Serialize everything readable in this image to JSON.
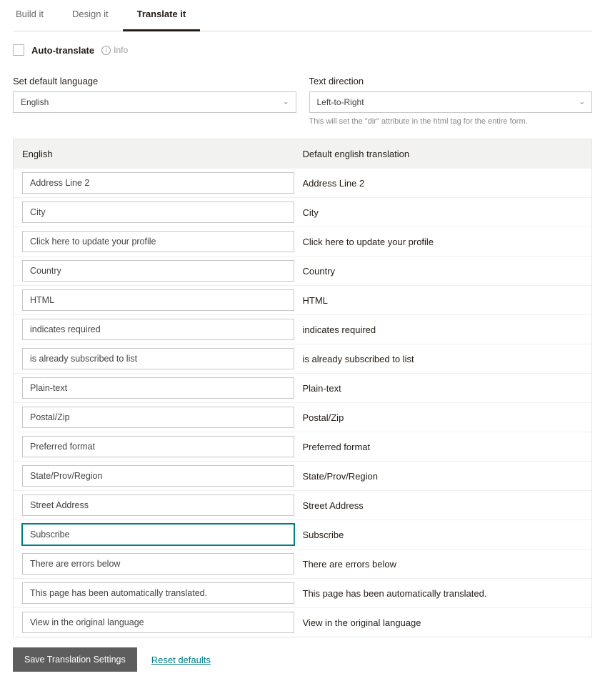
{
  "tabs": {
    "build": "Build it",
    "design": "Design it",
    "translate": "Translate it"
  },
  "autoTranslate": {
    "label": "Auto-translate",
    "info": "Info"
  },
  "defaultLanguage": {
    "label": "Set default language",
    "value": "English"
  },
  "textDirection": {
    "label": "Text direction",
    "value": "Left-to-Right",
    "help": "This will set the \"dir\" attribute in the html tag for the entire form."
  },
  "tableHeader": {
    "left": "English",
    "right": "Default english translation"
  },
  "rows": [
    {
      "input": "Address Line 2",
      "default": "Address Line 2",
      "focused": false
    },
    {
      "input": "City",
      "default": "City",
      "focused": false
    },
    {
      "input": "Click here to update your profile",
      "default": "Click here to update your profile",
      "focused": false
    },
    {
      "input": "Country",
      "default": "Country",
      "focused": false
    },
    {
      "input": "HTML",
      "default": "HTML",
      "focused": false
    },
    {
      "input": "indicates required",
      "default": "indicates required",
      "focused": false
    },
    {
      "input": "is already subscribed to list",
      "default": "is already subscribed to list",
      "focused": false
    },
    {
      "input": "Plain-text",
      "default": "Plain-text",
      "focused": false
    },
    {
      "input": "Postal/Zip",
      "default": "Postal/Zip",
      "focused": false
    },
    {
      "input": "Preferred format",
      "default": "Preferred format",
      "focused": false
    },
    {
      "input": "State/Prov/Region",
      "default": "State/Prov/Region",
      "focused": false
    },
    {
      "input": "Street Address",
      "default": "Street Address",
      "focused": false
    },
    {
      "input": "Subscribe",
      "default": "Subscribe",
      "focused": true
    },
    {
      "input": "There are errors below",
      "default": "There are errors below",
      "focused": false
    },
    {
      "input": "This page has been automatically translated.",
      "default": "This page has been automatically translated.",
      "focused": false
    },
    {
      "input": "View in the original language",
      "default": "View in the original language",
      "focused": false
    }
  ],
  "actions": {
    "save": "Save Translation Settings",
    "reset": "Reset defaults"
  }
}
